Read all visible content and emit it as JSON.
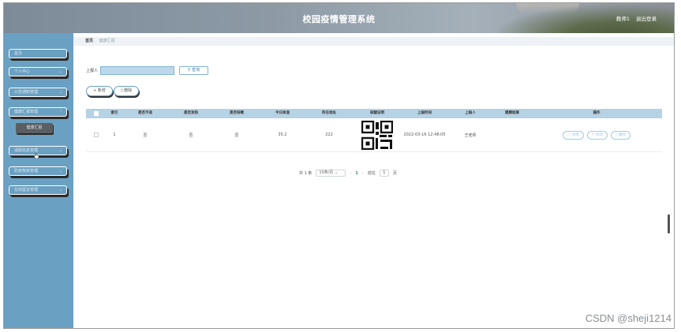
{
  "header": {
    "title": "校园疫情管理系统",
    "user_label": "教师1",
    "logout_label": "退出登录"
  },
  "sidebar": {
    "items": [
      {
        "label": "首页",
        "has_chevron": false
      },
      {
        "label": "个人中心",
        "has_chevron": true
      },
      {
        "label": "公告通知管理",
        "has_chevron": true
      },
      {
        "label": "健康汇报管理",
        "has_chevron": true
      },
      {
        "label": "请假信息管理",
        "has_chevron": true
      },
      {
        "label": "防疫物资管理",
        "has_chevron": true
      },
      {
        "label": "在线留言管理",
        "has_chevron": true
      }
    ],
    "active_submenu": "健康汇报"
  },
  "breadcrumb": {
    "home": "首页",
    "current": "健康汇报"
  },
  "search": {
    "label": "上报人",
    "value": "",
    "button_label": "查询"
  },
  "actions": {
    "add_label": "新增",
    "delete_label": "删除"
  },
  "table": {
    "columns": [
      "",
      "索引",
      "是否不适",
      "是否发热",
      "是否咳嗽",
      "今日体温",
      "所在地址",
      "核酸证明",
      "上报时间",
      "上报人",
      "健康结果",
      "操作"
    ],
    "rows": [
      {
        "index": "1",
        "unwell": "否",
        "fever": "否",
        "cough": "否",
        "temperature": "35.2",
        "address": "222",
        "report_time": "2022-03-16 12:48:05",
        "reporter": "王老师",
        "result": ""
      }
    ],
    "op_labels": {
      "detail": "详情",
      "edit": "修改",
      "delete": "删除"
    }
  },
  "pagination": {
    "total": "共 1 条",
    "page_size": "10条/页",
    "current_page": "1",
    "goto_label": "前往",
    "goto_value": "1",
    "page_unit": "页"
  },
  "watermark": "CSDN @sheji1214",
  "colors": {
    "sidebar": "#6aa0c2",
    "table_header": "#b6d2e5",
    "accent": "#3a7fb0"
  }
}
